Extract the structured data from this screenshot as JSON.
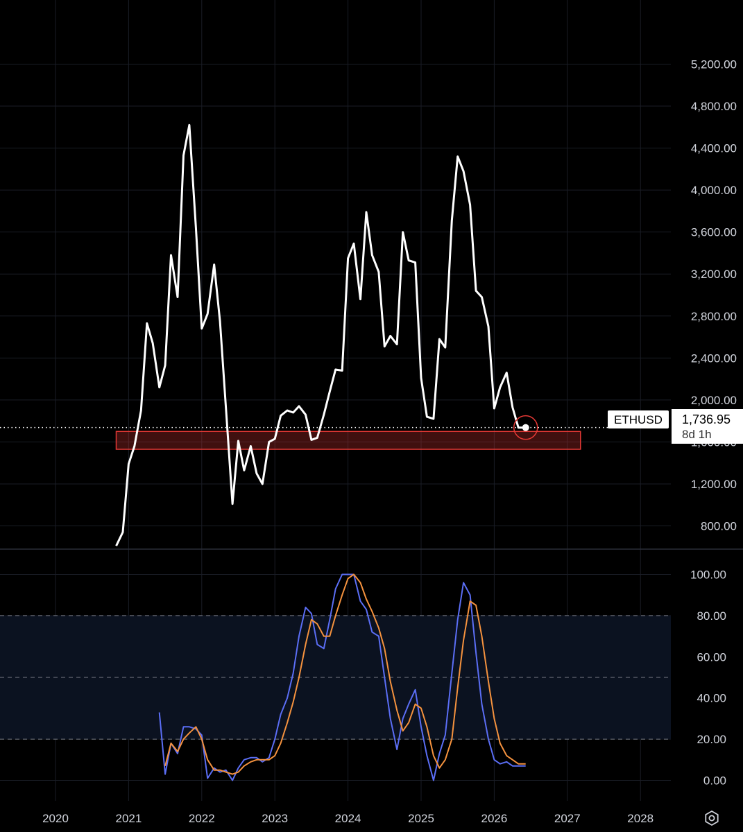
{
  "chart_data": [
    {
      "type": "line",
      "name": "price-panel",
      "ticker": "ETHUSD",
      "last_price": "1,736.95",
      "countdown": "8d 1h",
      "ylim": [
        600,
        5300
      ],
      "y_ticks": [
        "800.00",
        "1,200.00",
        "1,600.00",
        "2,000.00",
        "2,400.00",
        "2,800.00",
        "3,200.00",
        "3,600.00",
        "4,000.00",
        "4,400.00",
        "4,800.00",
        "5,200.00"
      ],
      "y_tick_values": [
        800,
        1200,
        1600,
        2000,
        2400,
        2800,
        3200,
        3600,
        4000,
        4400,
        4800,
        5200
      ],
      "support_zone": {
        "x_start": 2020.83,
        "x_end": 2027.18,
        "y_low": 1530,
        "y_high": 1700,
        "color": "#e53935"
      },
      "highlight_point": {
        "x": 2026.43,
        "y": 1736.95
      },
      "line_color": "#ffffff",
      "x": [
        2020.83,
        2020.92,
        2021.0,
        2021.08,
        2021.17,
        2021.25,
        2021.33,
        2021.42,
        2021.5,
        2021.58,
        2021.67,
        2021.75,
        2021.83,
        2021.92,
        2022.0,
        2022.08,
        2022.17,
        2022.25,
        2022.33,
        2022.42,
        2022.5,
        2022.58,
        2022.67,
        2022.75,
        2022.83,
        2022.92,
        2023.0,
        2023.08,
        2023.17,
        2023.25,
        2023.33,
        2023.42,
        2023.5,
        2023.58,
        2023.67,
        2023.75,
        2023.83,
        2023.92,
        2024.0,
        2024.08,
        2024.17,
        2024.25,
        2024.33,
        2024.42,
        2024.5,
        2024.58,
        2024.67,
        2024.75,
        2024.83,
        2024.92,
        2025.0,
        2025.08,
        2025.17,
        2025.25,
        2025.33,
        2025.42,
        2025.5,
        2025.58,
        2025.67,
        2025.75,
        2025.83,
        2025.92,
        2026.0,
        2026.08,
        2026.17,
        2026.25,
        2026.33,
        2026.43
      ],
      "values": [
        610,
        740,
        1390,
        1560,
        1900,
        2730,
        2540,
        2120,
        2330,
        3380,
        2980,
        4330,
        4620,
        3640,
        2680,
        2820,
        3290,
        2750,
        1930,
        1010,
        1610,
        1330,
        1560,
        1300,
        1200,
        1600,
        1630,
        1850,
        1900,
        1880,
        1940,
        1860,
        1620,
        1640,
        1860,
        2080,
        2290,
        2280,
        3350,
        3490,
        2960,
        3790,
        3380,
        3220,
        2510,
        2610,
        2530,
        3600,
        3330,
        3310,
        2210,
        1840,
        1820,
        2580,
        2500,
        3710,
        4320,
        4180,
        3860,
        3040,
        2980,
        2700,
        1920,
        2120,
        2260,
        1930,
        1736.95,
        1736.95
      ]
    },
    {
      "type": "line",
      "name": "stoch-rsi-panel",
      "ylim": [
        -5,
        105
      ],
      "y_ticks": [
        "0.00",
        "20.00",
        "40.00",
        "60.00",
        "80.00",
        "100.00"
      ],
      "y_tick_values": [
        0,
        20,
        40,
        60,
        80,
        100
      ],
      "bands": {
        "upper": 80,
        "middle": 50,
        "lower": 20,
        "fill": "#0b1220"
      },
      "series": [
        {
          "color": "#5b6ef5",
          "x": [
            2021.42,
            2021.5,
            2021.58,
            2021.67,
            2021.75,
            2021.83,
            2021.92,
            2022.0,
            2022.08,
            2022.17,
            2022.25,
            2022.33,
            2022.42,
            2022.5,
            2022.58,
            2022.67,
            2022.75,
            2022.83,
            2022.92,
            2023.0,
            2023.08,
            2023.17,
            2023.25,
            2023.33,
            2023.42,
            2023.5,
            2023.58,
            2023.67,
            2023.75,
            2023.83,
            2023.92,
            2024.0,
            2024.08,
            2024.17,
            2024.25,
            2024.33,
            2024.42,
            2024.5,
            2024.58,
            2024.67,
            2024.75,
            2024.83,
            2024.92,
            2025.0,
            2025.08,
            2025.17,
            2025.25,
            2025.33,
            2025.42,
            2025.5,
            2025.58,
            2025.67,
            2025.75,
            2025.83,
            2025.92,
            2026.0,
            2026.08,
            2026.17,
            2026.25,
            2026.33,
            2026.43
          ],
          "values": [
            33,
            3,
            18,
            13,
            26,
            26,
            25,
            22,
            1,
            6,
            4,
            5,
            0,
            6,
            10,
            11,
            11,
            9,
            11,
            20,
            32,
            40,
            52,
            70,
            84,
            81,
            66,
            64,
            78,
            93,
            100,
            100,
            100,
            87,
            83,
            72,
            70,
            50,
            30,
            15,
            30,
            37,
            44,
            26,
            12,
            0,
            13,
            22,
            52,
            78,
            96,
            90,
            62,
            37,
            20,
            10,
            8,
            9,
            7,
            7,
            7
          ]
        },
        {
          "color": "#f5923e",
          "x": [
            2021.5,
            2021.58,
            2021.67,
            2021.75,
            2021.83,
            2021.92,
            2022.0,
            2022.08,
            2022.17,
            2022.25,
            2022.33,
            2022.42,
            2022.5,
            2022.58,
            2022.67,
            2022.75,
            2022.83,
            2022.92,
            2023.0,
            2023.08,
            2023.17,
            2023.25,
            2023.33,
            2023.42,
            2023.5,
            2023.58,
            2023.67,
            2023.75,
            2023.83,
            2023.92,
            2024.0,
            2024.08,
            2024.17,
            2024.25,
            2024.33,
            2024.42,
            2024.5,
            2024.58,
            2024.67,
            2024.75,
            2024.83,
            2024.92,
            2025.0,
            2025.08,
            2025.17,
            2025.25,
            2025.33,
            2025.42,
            2025.5,
            2025.58,
            2025.67,
            2025.75,
            2025.83,
            2025.92,
            2026.0,
            2026.08,
            2026.17,
            2026.25,
            2026.33,
            2026.43
          ],
          "values": [
            7,
            18,
            14,
            20,
            23,
            26,
            20,
            10,
            5,
            5,
            4,
            3,
            4,
            7,
            9,
            10,
            10,
            10,
            12,
            18,
            28,
            38,
            50,
            66,
            78,
            76,
            70,
            70,
            80,
            90,
            98,
            100,
            96,
            88,
            82,
            74,
            64,
            48,
            34,
            24,
            28,
            37,
            35,
            26,
            12,
            6,
            10,
            20,
            45,
            68,
            87,
            85,
            70,
            48,
            30,
            18,
            12,
            10,
            8,
            8
          ]
        }
      ]
    },
    {
      "type": "axis",
      "name": "time-axis",
      "x_ticks": [
        "2020",
        "2021",
        "2022",
        "2023",
        "2024",
        "2025",
        "2026",
        "2027",
        "2028"
      ],
      "x_tick_values": [
        2020,
        2021,
        2022,
        2023,
        2024,
        2025,
        2026,
        2027,
        2028
      ]
    }
  ],
  "colors": {
    "background": "#000000",
    "grid": "#1a1d26",
    "text": "#d1d4dc"
  },
  "icons": {
    "settings": "gear-icon"
  }
}
